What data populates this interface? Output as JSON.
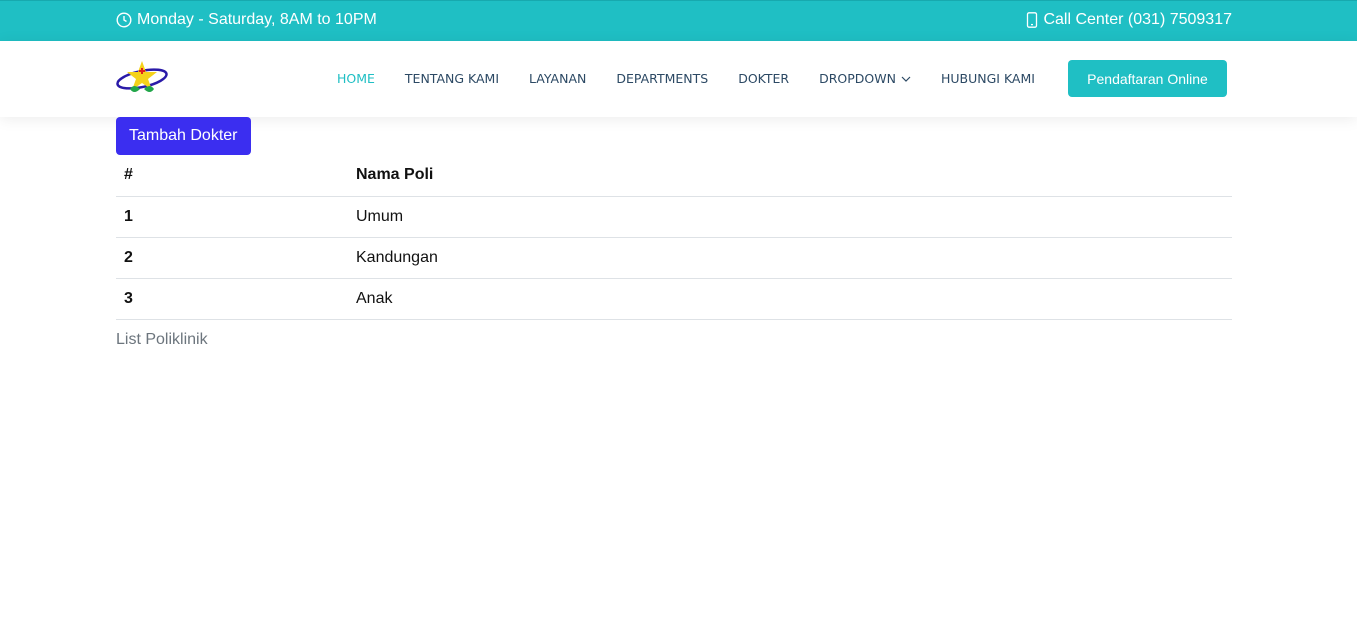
{
  "topbar": {
    "hours": "Monday - Saturday, 8AM to 10PM",
    "phone": "Call Center (031) 7509317",
    "clock_icon": "clock-icon",
    "phone_icon": "phone-icon"
  },
  "nav": {
    "items": [
      {
        "label": "HOME",
        "active": true
      },
      {
        "label": "TENTANG KAMI"
      },
      {
        "label": "LAYANAN"
      },
      {
        "label": "DEPARTMENTS"
      },
      {
        "label": "DOKTER"
      },
      {
        "label": "DROPDOWN",
        "has_caret": true
      },
      {
        "label": "HUBUNGI KAMI"
      }
    ],
    "cta": "Pendaftaran Online"
  },
  "main": {
    "add_button": "Tambah Dokter",
    "table": {
      "headers": [
        "#",
        "Nama Poli"
      ],
      "rows": [
        [
          "1",
          "Umum"
        ],
        [
          "2",
          "Kandungan"
        ],
        [
          "3",
          "Anak"
        ]
      ]
    },
    "caption": "List Poliklinik"
  },
  "colors": {
    "accent": "#1fbfc4",
    "button": "#3b2ef0"
  }
}
